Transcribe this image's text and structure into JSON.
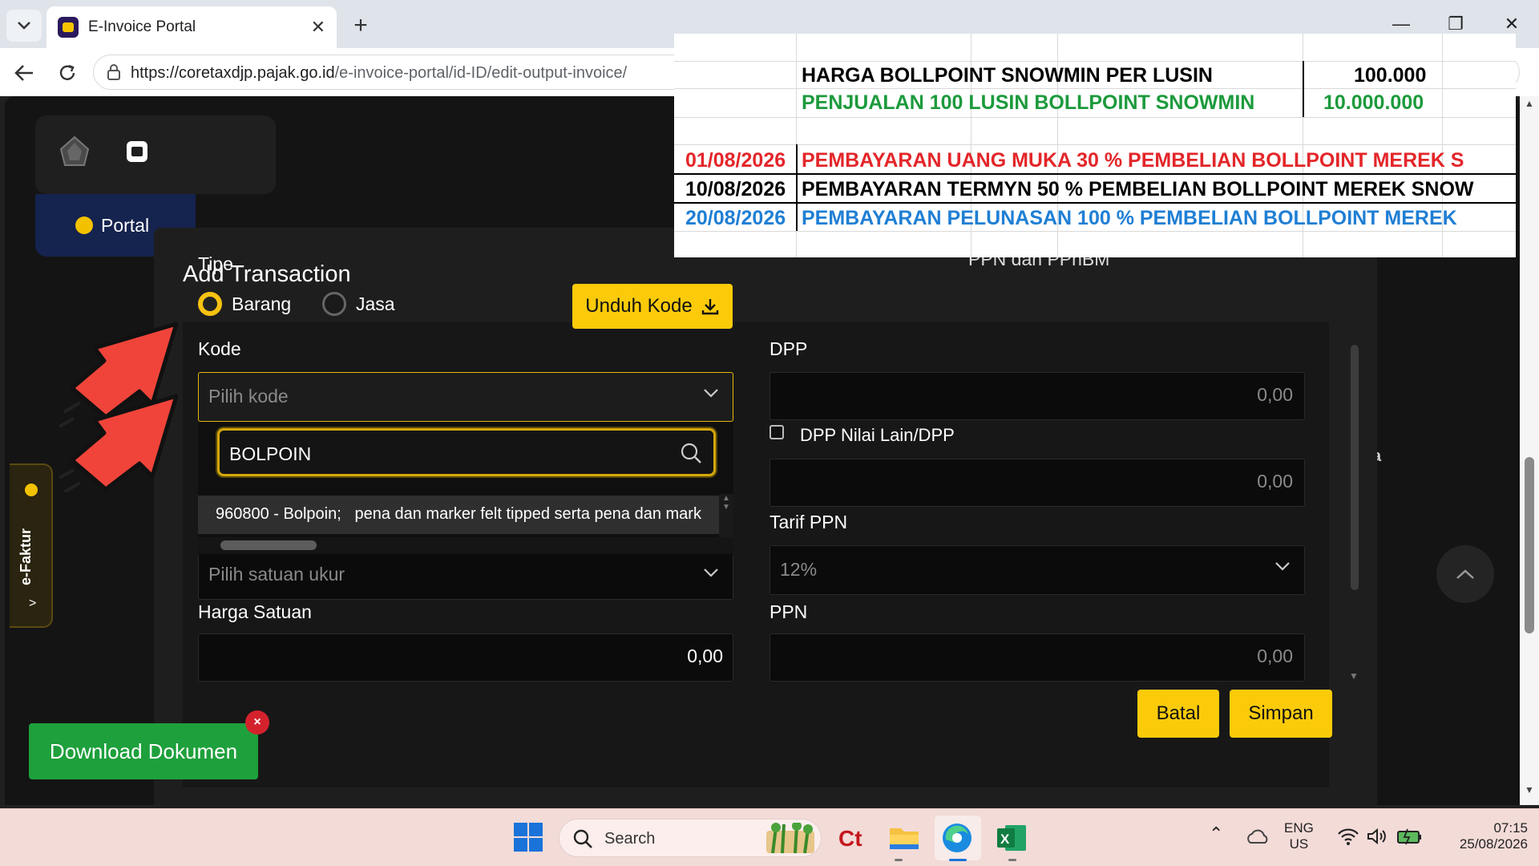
{
  "browser": {
    "tab_title": "E-Invoice Portal",
    "url_host": "https://coretaxdjp.pajak.go.id",
    "url_path": "/e-invoice-portal/id-ID/edit-output-invoice/"
  },
  "background": {
    "portal_label": "Portal",
    "side_tab_label": "e-Faktur",
    "side_tab_arrow": ">",
    "right_letter": "a"
  },
  "modal": {
    "title": "Add Transaction",
    "tipe_label": "Tipe",
    "radio_barang": "Barang",
    "radio_jasa": "Jasa",
    "unduh_kode": "Unduh Kode",
    "kode_label": "Kode",
    "kode_placeholder": "Pilih kode",
    "search_value": "BOLPOIN",
    "option_text": "960800 - Bolpoin;   pena dan marker felt tipped serta pena dan mark",
    "satuan_placeholder": "Pilih satuan ukur",
    "harga_label": "Harga Satuan",
    "harga_value": "0,00",
    "section_right": "PPN dan PPnBM",
    "dpp_label": "DPP",
    "dpp_value": "0,00",
    "dpp_nilai_lain_label": "DPP Nilai Lain/DPP",
    "dpp_nilai_lain_value": "0,00",
    "tarif_label": "Tarif PPN",
    "tarif_value": "12%",
    "ppn_label": "PPN",
    "ppn_value": "0,00",
    "batal": "Batal",
    "simpan": "Simpan"
  },
  "download": {
    "label": "Download Dokumen",
    "close": "×"
  },
  "sheet": {
    "row1_label": "HARGA BOLLPOINT SNOWMIN PER LUSIN",
    "row1_value": "100.000",
    "row2_label": "PENJUALAN 100 LUSIN BOLLPOINT SNOWMIN",
    "row2_value": "10.000.000",
    "rows": [
      {
        "date": "01/08/2026",
        "text": "PEMBAYARAN UANG MUKA 30 % PEMBELIAN BOLLPOINT MEREK S",
        "color": "#e3262a"
      },
      {
        "date": "10/08/2026",
        "text": "PEMBAYARAN TERMYN 50 % PEMBELIAN BOLLPOINT MEREK SNOW",
        "color": "#000000"
      },
      {
        "date": "20/08/2026",
        "text": "PEMBAYARAN PELUNASAN 100 % PEMBELIAN BOLLPOINT MEREK",
        "color": "#1f7fd4"
      }
    ]
  },
  "taskbar": {
    "search_label": "Search",
    "lang_line1": "ENG",
    "lang_line2": "US",
    "time": "07:15",
    "date": "25/08/2026"
  },
  "colors": {
    "accent_yellow": "#fbcb0a",
    "download_green": "#1ea03c",
    "annotation_red": "#f0443a"
  }
}
